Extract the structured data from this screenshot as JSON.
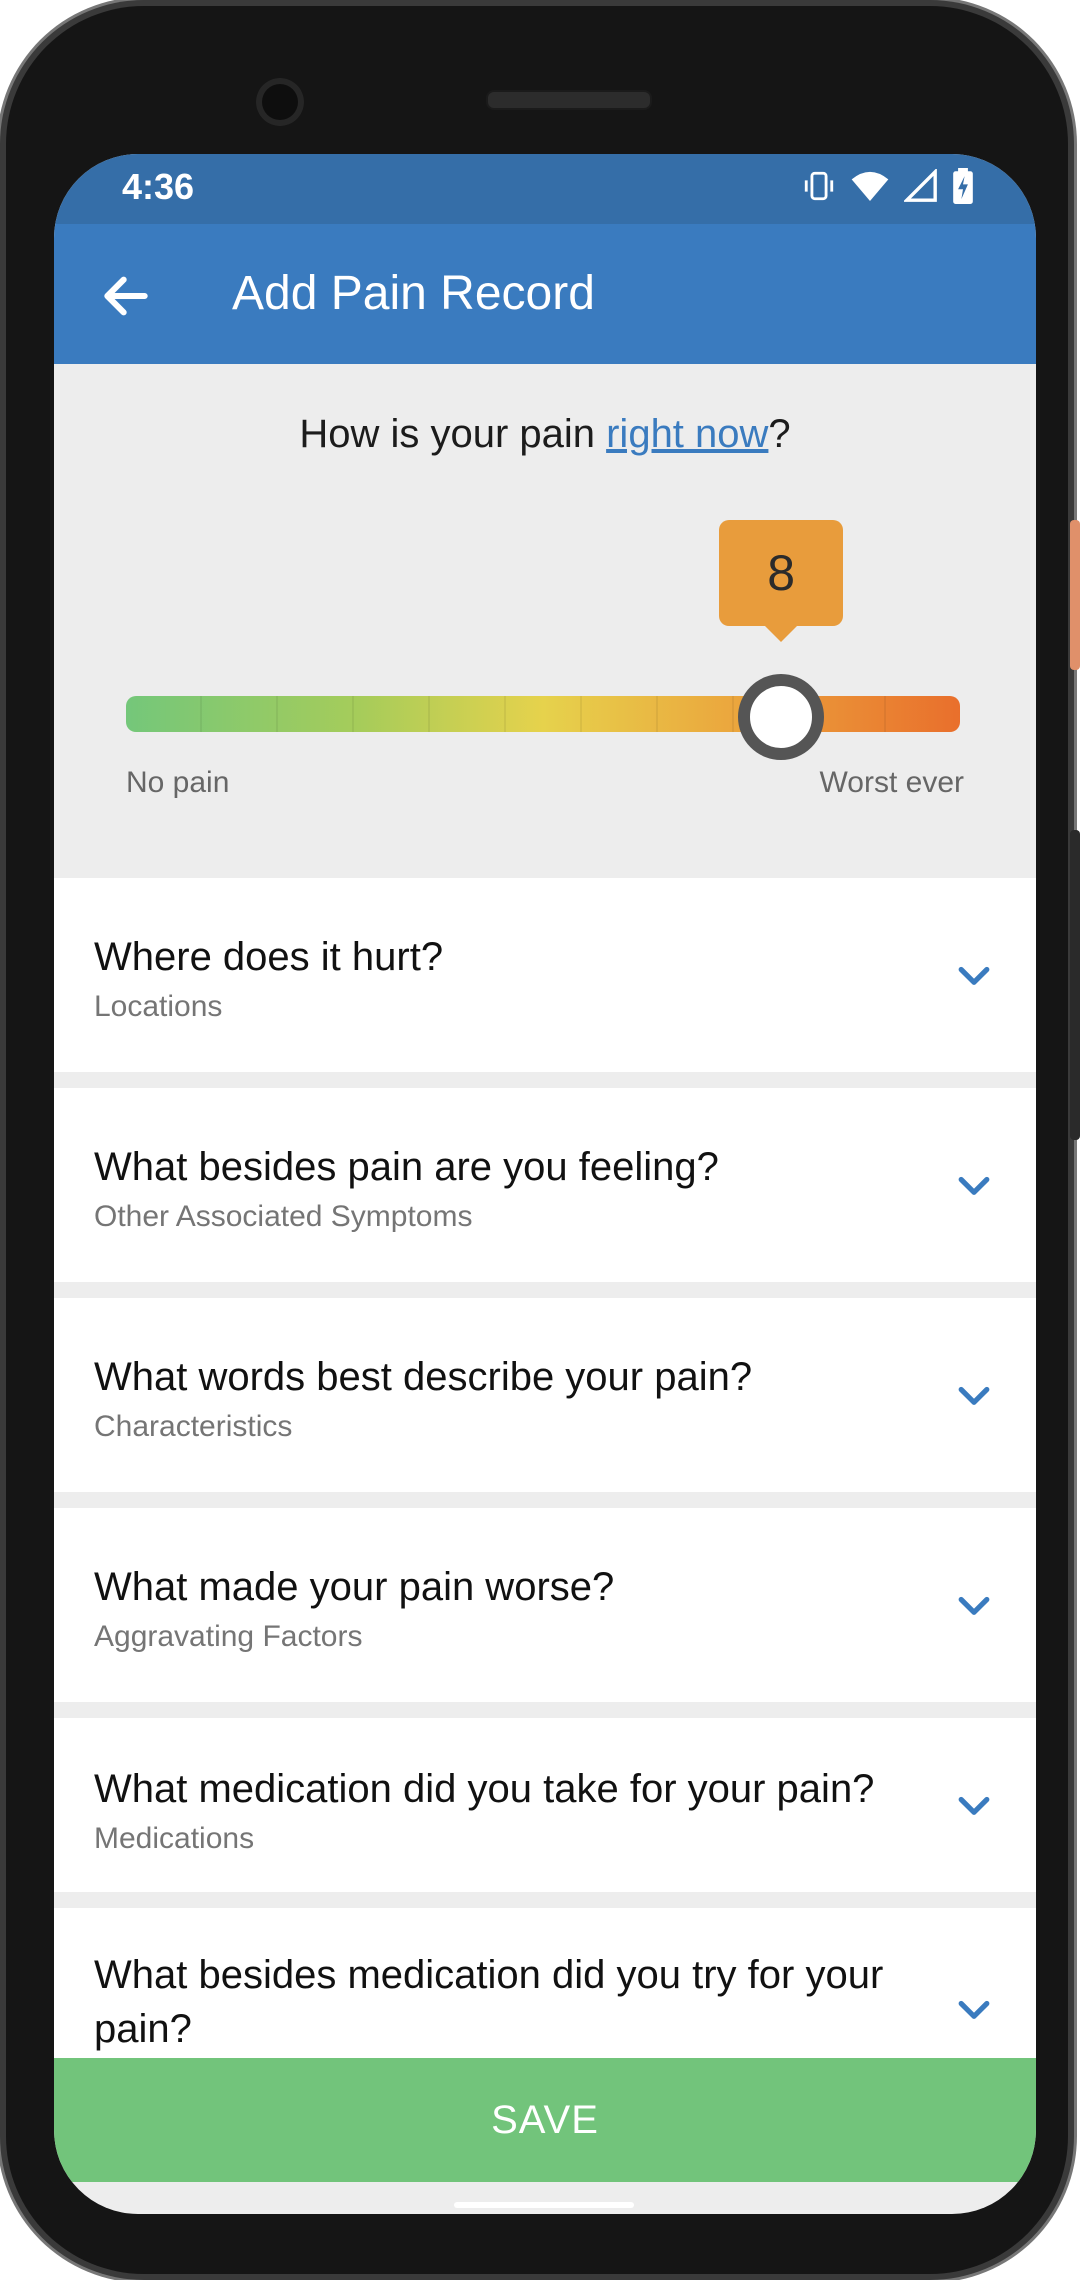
{
  "status_bar": {
    "time": "4:36"
  },
  "app_bar": {
    "title": "Add Pain Record"
  },
  "pain": {
    "question_prefix": "How is your pain ",
    "question_link": "right now",
    "question_suffix": "?",
    "value": "8",
    "scale_min_label": "No pain",
    "scale_max_label": "Worst ever",
    "level": 8,
    "max_level": 10
  },
  "sections": [
    {
      "title": "Where does it hurt?",
      "subtitle": "Locations"
    },
    {
      "title": "What besides pain are you feeling?",
      "subtitle": "Other Associated Symptoms"
    },
    {
      "title": "What words best describe your pain?",
      "subtitle": "Characteristics"
    },
    {
      "title": "What made your pain worse?",
      "subtitle": "Aggravating Factors"
    },
    {
      "title": "What medication did you take for your pain?",
      "subtitle": "Medications"
    },
    {
      "title": "What besides medication did you try for your pain?",
      "subtitle": ""
    }
  ],
  "save_label": "SAVE",
  "colors": {
    "status_bar": "#356ea8",
    "app_bar": "#3a7bbf",
    "bubble": "#e89c3c",
    "save_button": "#72c47b",
    "chevron": "#3a7bbf"
  }
}
